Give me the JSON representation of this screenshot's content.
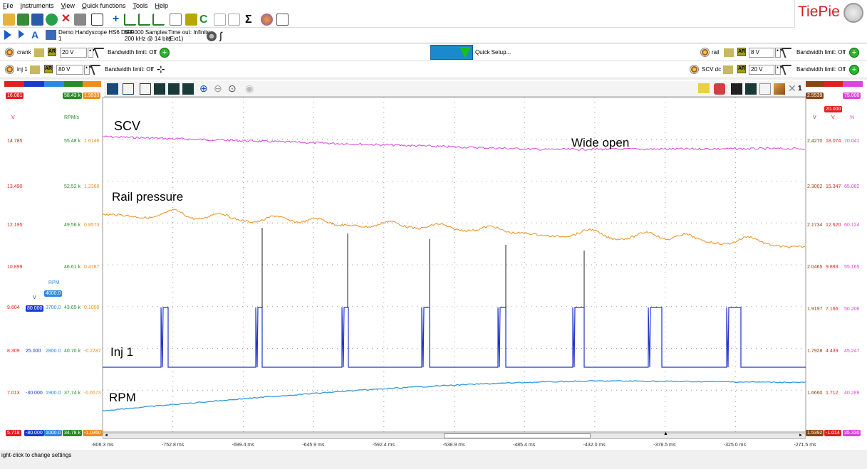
{
  "menu": [
    "File",
    "Instruments",
    "View",
    "Quick functions",
    "Tools",
    "Help"
  ],
  "logo_text": "TiePie",
  "instrument": {
    "name": "Demo Handyscope HS6 DIFF",
    "index": "1",
    "samples": "500000 Samples",
    "rate": "200 kHz @ 14 bits",
    "timeout": "Time out: Infinite",
    "trigger": "(Ext1)"
  },
  "channels": {
    "crank": {
      "label": "crank",
      "ar": "AR",
      "range": "20 V",
      "bw": "Bandwidth limit: Off"
    },
    "inj1": {
      "label": "inj 1",
      "ar": "AR",
      "range": "80 V",
      "bw": "Bandwidth limit: Off"
    },
    "rail": {
      "label": "rail",
      "ar": "AR",
      "range": "8 V",
      "bw": "Bandwidth limit: Off"
    },
    "scvdc": {
      "label": "SCV dc",
      "ar": "AR",
      "range": "20 V",
      "bw": "Bandwidth limit: Off"
    }
  },
  "quick_setup": "Quick Setup...",
  "colors": {
    "scv": "#dd44dd",
    "rail": "#f08c1e",
    "inj": "#2233cc",
    "rpm": "#3399dd",
    "red": "#e02020",
    "green": "#2a8a2a",
    "brown": "#8b4513"
  },
  "left_scales": {
    "top": {
      "c1": "16.081",
      "c4": "58.43 k",
      "c5": "1.9933"
    },
    "units": {
      "c1": "V",
      "c4": "RPM/s"
    },
    "rows": [
      {
        "c1": "14.785",
        "c4": "55.48 k",
        "c5": "1.6146"
      },
      {
        "c1": "13.490",
        "c4": "52.52 k",
        "c5": "1.2360"
      },
      {
        "c1": "12.195",
        "c4": "49.56 k",
        "c5": "0.8573"
      },
      {
        "c1": "10.899",
        "c4": "46.61 k",
        "c5": "0.4787"
      },
      {
        "c1": "9.604",
        "c2": "80.000",
        "c3": "3700.0",
        "c4": "43.65 k",
        "c5": "0.1000"
      },
      {
        "c1": "8.309",
        "c2": "25.000",
        "c3": "2800.0",
        "c4": "40.70 k",
        "c5": "-0.2787"
      },
      {
        "c1": "7.013",
        "c2": "-30.000",
        "c3": "1900.0",
        "c4": "37.74 k",
        "c5": "-0.6573"
      }
    ],
    "bottom": {
      "c1": "5.718",
      "c2": "-80.000",
      "c3": "1000.0",
      "c4": "34.78 k",
      "c5": "-1.0360"
    },
    "rpm_label": "RPM",
    "rpm_value": "4000.0",
    "v_label": "V"
  },
  "right_scales": {
    "top": {
      "c1": "2.5539",
      "c3": "75.000"
    },
    "units": {
      "c1": "V",
      "c2": "V",
      "c3": "%"
    },
    "c2_top": "20.000",
    "rows": [
      {
        "c1": "2.4270",
        "c2": "18.074",
        "c3": "70.041"
      },
      {
        "c1": "2.3002",
        "c2": "15.347",
        "c3": "65.082"
      },
      {
        "c1": "2.1734",
        "c2": "12.620",
        "c3": "60.124"
      },
      {
        "c1": "2.0465",
        "c2": "9.893",
        "c3": "55.165"
      },
      {
        "c1": "1.9197",
        "c2": "7.166",
        "c3": "50.206"
      },
      {
        "c1": "1.7928",
        "c2": "4.439",
        "c3": "45.247"
      },
      {
        "c1": "1.6660",
        "c2": "1.712",
        "c3": "40.289"
      }
    ],
    "bottom": {
      "c1": "1.5392",
      "c2": "-1.014",
      "c3": "35.330"
    }
  },
  "annotations": {
    "scv": "SCV",
    "wide_open": "Wide open",
    "rail": "Rail pressure",
    "inj": "Inj 1",
    "rpm": "RPM"
  },
  "x_ticks": [
    "-806.3 ms",
    "-752.8 ms",
    "-699.4 ms",
    "-645.9 ms",
    "-592.4 ms",
    "-538.9 ms",
    "-485.4 ms",
    "-432.0 ms",
    "-378.5 ms",
    "-325.0 ms",
    "-271.5 ms"
  ],
  "scope_toolbar_right_value": "1",
  "status": "ight-click to change settings"
}
